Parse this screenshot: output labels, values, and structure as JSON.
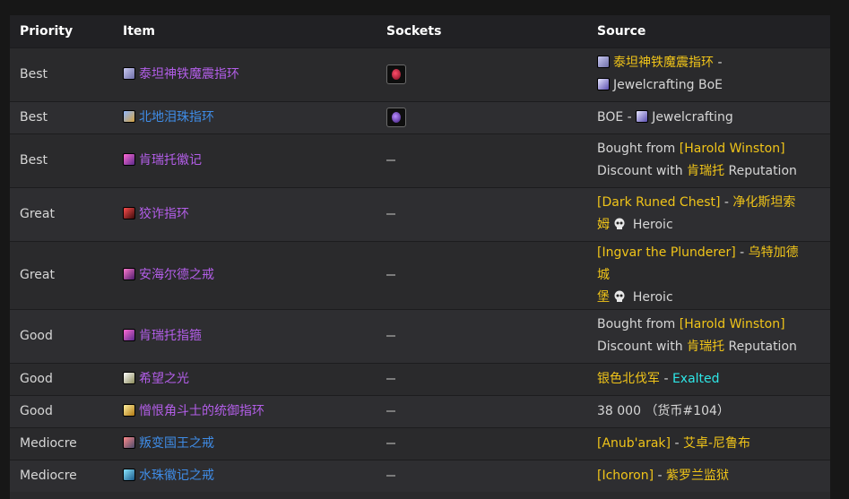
{
  "headers": {
    "priority": "Priority",
    "item": "Item",
    "sockets": "Sockets",
    "source": "Source"
  },
  "rows": [
    {
      "priority": "Best",
      "item": {
        "name": "泰坦神铁魔震指环",
        "icon": "ring-icon"
      },
      "socket": "red",
      "source": {
        "l1a": "泰坦神铁魔震指环",
        "sep1": " - ",
        "l2a": "Jewelcrafting BoE"
      }
    },
    {
      "priority": "Best",
      "item": {
        "name": "北地泪珠指环",
        "icon": "ring-icon"
      },
      "socket": "purple",
      "source": {
        "pre": "BOE - ",
        "l1a": "Jewelcrafting"
      }
    },
    {
      "priority": "Best",
      "item": {
        "name": "肯瑞托徽记",
        "icon": "signet-icon"
      },
      "source": {
        "p1": "Bought from ",
        "v1": "[Harold Winston]",
        "p2": "Discount with ",
        "v2": "肯瑞托",
        "p3": " Reputation"
      }
    },
    {
      "priority": "Great",
      "item": {
        "name": "狡诈指环",
        "icon": "ring-icon"
      },
      "source": {
        "v1": "[Dark Runed Chest]",
        "p1": " - ",
        "v2": "净化斯坦索",
        "v3": "姆",
        "p2": " Heroic"
      }
    },
    {
      "priority": "Great",
      "item": {
        "name": "安海尔德之戒",
        "icon": "ring-icon"
      },
      "source": {
        "v1": "[Ingvar the Plunderer]",
        "p1": " - ",
        "v2": "乌特加德城",
        "v3": "堡",
        "p2": " Heroic"
      }
    },
    {
      "priority": "Good",
      "item": {
        "name": "肯瑞托指箍",
        "icon": "signet-icon"
      },
      "source": {
        "p1": "Bought from ",
        "v1": "[Harold Winston]",
        "p2": "Discount with ",
        "v2": "肯瑞托",
        "p3": " Reputation"
      }
    },
    {
      "priority": "Good",
      "item": {
        "name": "希望之光",
        "icon": "light-icon"
      },
      "source": {
        "v1": "银色北伐军",
        "p1": " - ",
        "v2": "Exalted"
      }
    },
    {
      "priority": "Good",
      "item": {
        "name": "憎恨角斗士的统御指环",
        "icon": "gladiator-ring-icon"
      },
      "source": {
        "p1": "38 000 （货币#104）"
      }
    },
    {
      "priority": "Mediocre",
      "item": {
        "name": "叛变国王之戒",
        "icon": "ring-icon"
      },
      "source": {
        "v1": "[Anub'arak]",
        "p1": " - ",
        "v2": "艾卓-尼鲁布"
      }
    },
    {
      "priority": "Mediocre",
      "item": {
        "name": "水珠徽记之戒",
        "icon": "ring-icon"
      },
      "source": {
        "v1": "[Ichoron]",
        "p1": " - ",
        "v2": "紫罗兰监狱"
      }
    }
  ]
}
